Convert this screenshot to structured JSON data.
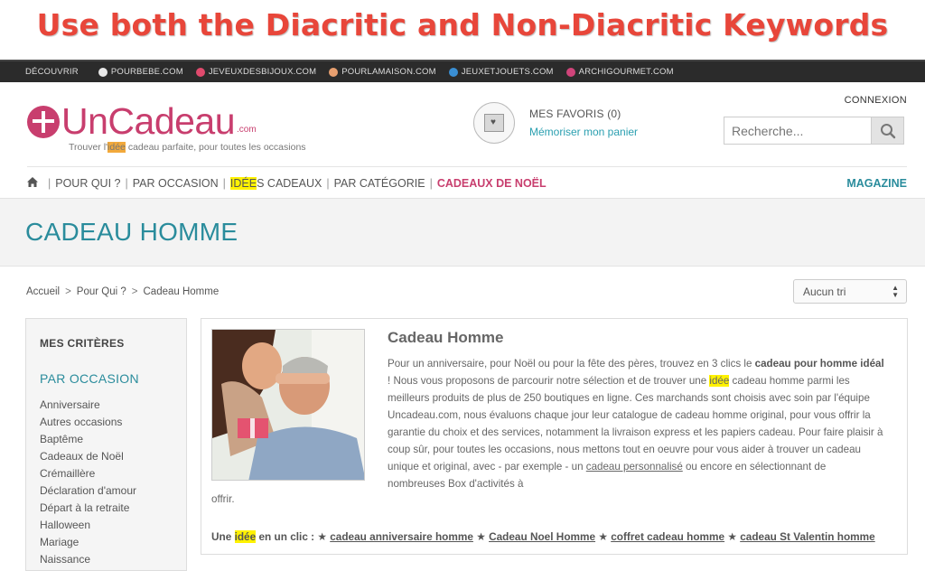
{
  "banner": {
    "text": "Use both the Diacritic and Non-Diacritic Keywords"
  },
  "topbar": {
    "discover": "DÉCOUVRIR",
    "sites": [
      {
        "label": "POURBEBE.COM",
        "color": "#e8e8e8",
        "icon": "baby-icon"
      },
      {
        "label": "JEVEUXDESBIJOUX.COM",
        "color": "#e04a6d",
        "icon": "jewel-icon"
      },
      {
        "label": "POURLAMAISON.COM",
        "color": "#e8a070",
        "icon": "house-icon"
      },
      {
        "label": "JEUXETJOUETS.COM",
        "color": "#3a8fd4",
        "icon": "toy-icon"
      },
      {
        "label": "ARCHIGOURMET.COM",
        "color": "#d0447a",
        "icon": "gourmet-icon"
      }
    ]
  },
  "header": {
    "connexion": "CONNEXION",
    "logo": {
      "name": "UnCadeau",
      "suffix": ".com"
    },
    "tagline": {
      "before": "Trouver l'",
      "highlight": "idée",
      "after": " cadeau parfaite, pour toutes les occasions"
    },
    "favorites": {
      "title": "MES FAVORIS",
      "count": "(0)",
      "link": "Mémoriser mon panier"
    },
    "search": {
      "placeholder": "Recherche..."
    }
  },
  "nav": {
    "items": [
      {
        "label": "POUR QUI ?"
      },
      {
        "label": "PAR OCCASION"
      },
      {
        "highlight": "IDÉE",
        "rest": "S CADEAUX"
      },
      {
        "label": "PAR CATÉGORIE"
      },
      {
        "label": "CADEAUX DE NOËL"
      }
    ],
    "magazine": "MAGAZINE"
  },
  "page": {
    "title": "CADEAU HOMME"
  },
  "breadcrumb": [
    "Accueil",
    "Pour Qui ?",
    "Cadeau Homme"
  ],
  "sort": {
    "selected": "Aucun tri"
  },
  "sidebar": {
    "title": "MES CRITÈRES",
    "subtitle": "PAR OCCASION",
    "items": [
      "Anniversaire",
      "Autres occasions",
      "Baptême",
      "Cadeaux de Noël",
      "Crémaillère",
      "Déclaration d'amour",
      "Départ à la retraite",
      "Halloween",
      "Mariage",
      "Naissance"
    ]
  },
  "content": {
    "title": "Cadeau Homme",
    "p1": "Pour un anniversaire, pour Noël ou pour la fête des pères, trouvez en 3 clics le ",
    "p1_bold": "cadeau pour homme idéal",
    "p2": " ! Nous vous proposons de parcourir notre sélection et de trouver une ",
    "p2_hl": "idée",
    "p3": " cadeau homme parmi les meilleurs produits de plus de 250 boutiques en ligne. Ces marchands sont choisis avec soin par l'équipe Uncadeau.com, nous évaluons chaque jour leur catalogue de cadeau homme original, pour vous offrir la garantie du choix et des services, notamment la livraison express et les papiers cadeau. Pour faire plaisir à coup sûr, pour toutes les occasions, nous mettons tout en oeuvre pour vous aider à trouver un cadeau unique et original, avec - par exemple - un ",
    "p3_link": "cadeau personnalisé",
    "p4": " ou encore en sélectionnant de nombreuses Box d'activités à",
    "tail": "offrir.",
    "links_prefix_1": "Une ",
    "links_hl": "idée",
    "links_prefix_2": " en un clic : ",
    "links": [
      "cadeau anniversaire homme",
      "Cadeau Noel Homme",
      "coffret cadeau homme",
      "cadeau St Valentin homme"
    ]
  }
}
